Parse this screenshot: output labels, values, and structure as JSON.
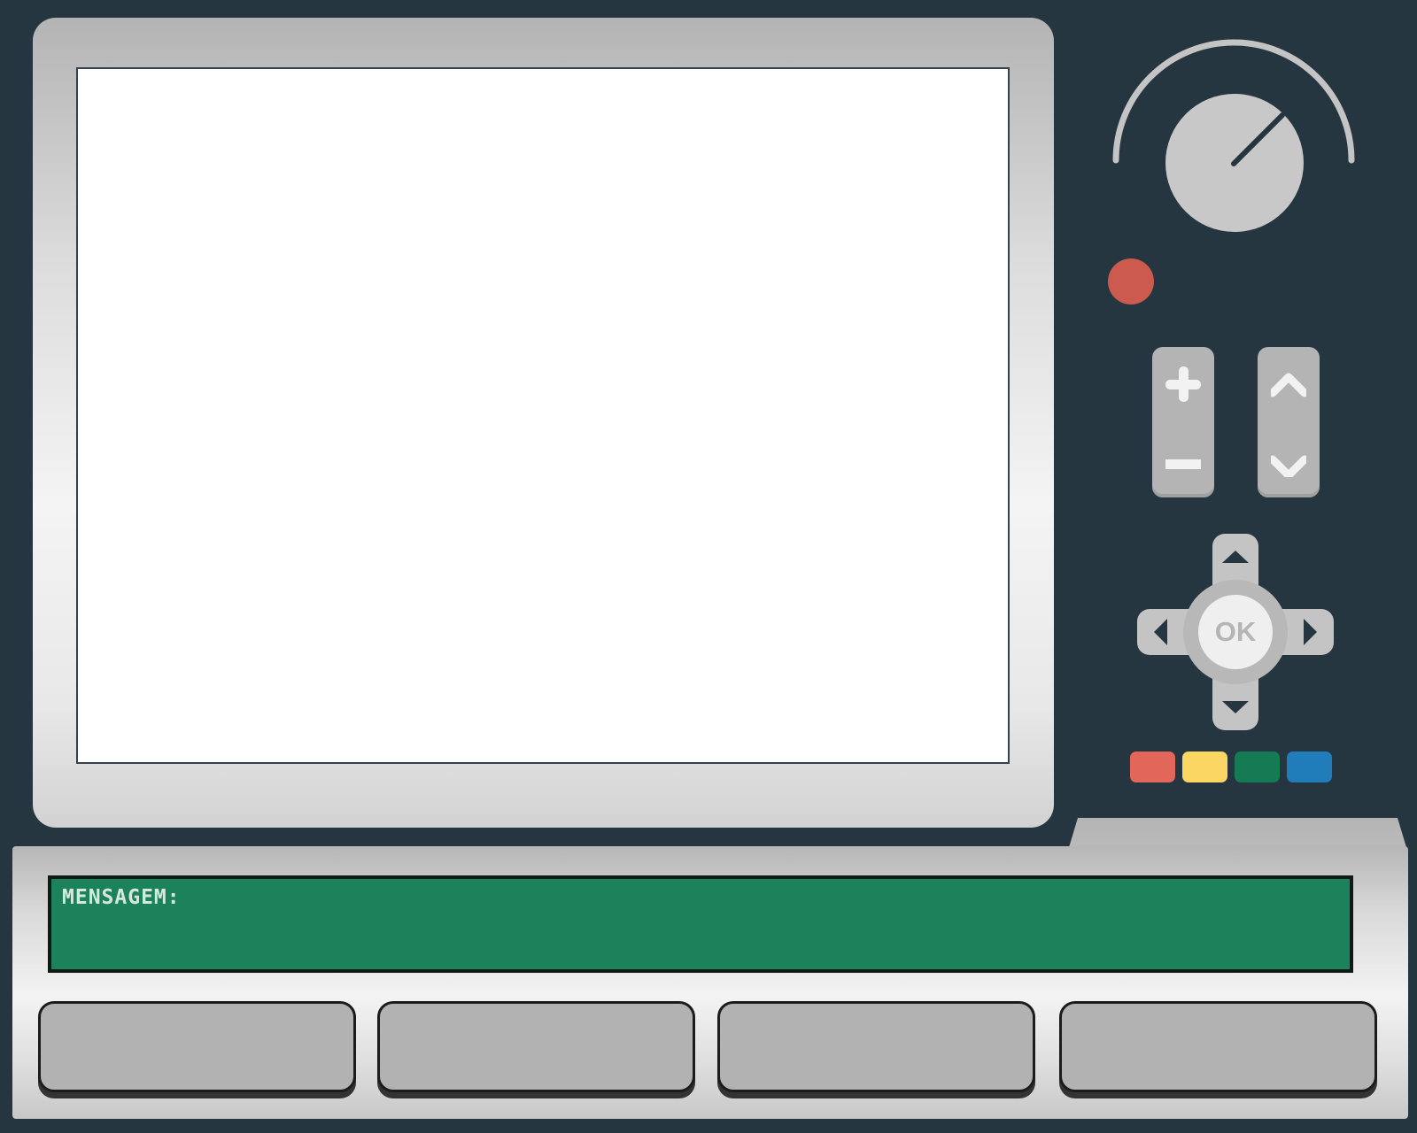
{
  "message": {
    "label": "MENSAGEM:"
  },
  "dpad": {
    "ok_label": "OK"
  },
  "colors": {
    "background": "#263640",
    "screen": "#ffffff",
    "message_panel": "#1c825c",
    "power_led": "#cc5a4e",
    "key_red": "#e2665a",
    "key_yellow": "#fcd663",
    "key_green": "#167a55",
    "key_blue": "#217dba"
  },
  "icons": {
    "knob": "dial-knob-icon",
    "volume_up": "plus-icon",
    "volume_down": "minus-icon",
    "channel_up": "chevron-up-icon",
    "channel_down": "chevron-down-icon",
    "dpad_up": "triangle-up-icon",
    "dpad_down": "triangle-down-icon",
    "dpad_left": "triangle-left-icon",
    "dpad_right": "triangle-right-icon"
  }
}
